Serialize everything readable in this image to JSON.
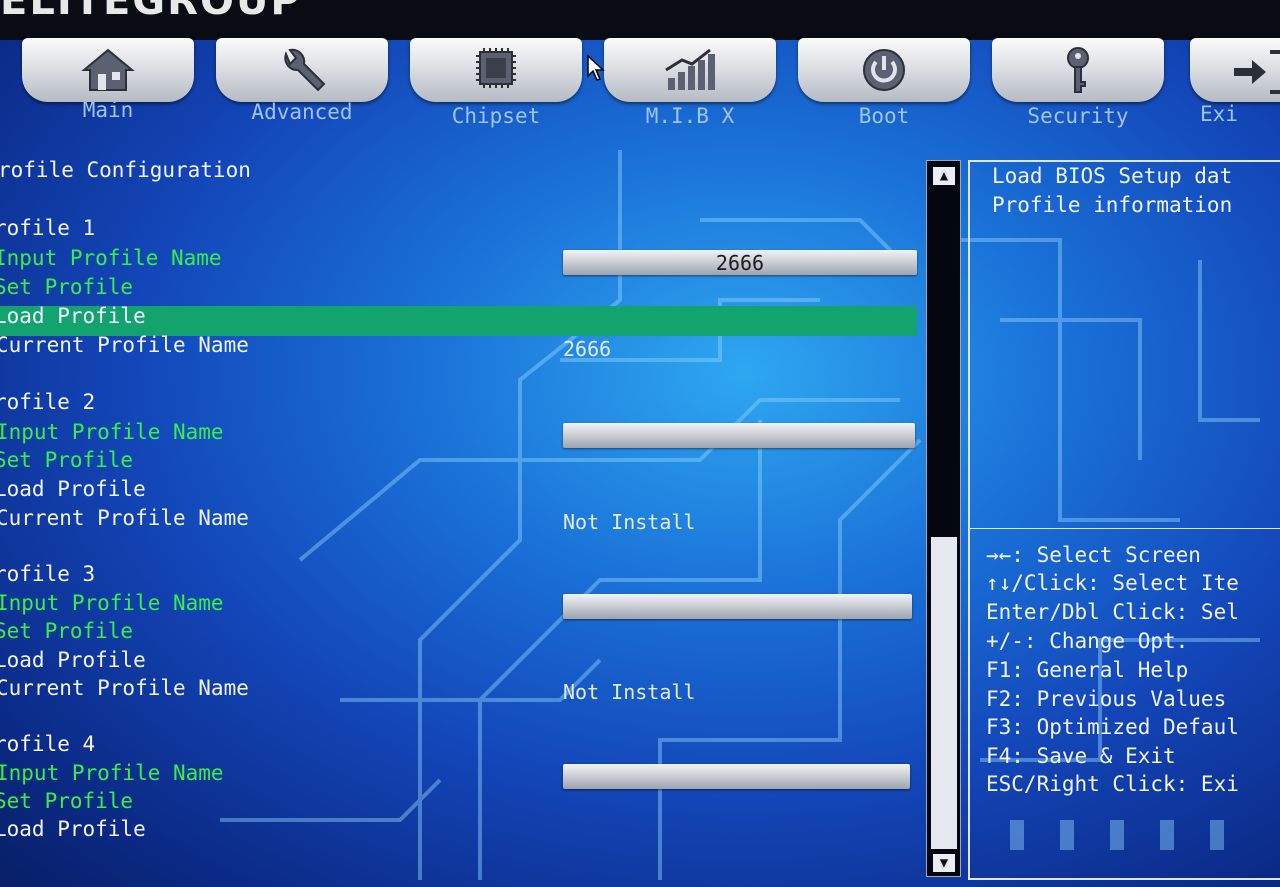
{
  "brand": "ELITEGROUP",
  "tabs": [
    {
      "label": "Main",
      "icon": "home-icon"
    },
    {
      "label": "Advanced",
      "icon": "wrench-icon"
    },
    {
      "label": "Chipset",
      "icon": "chip-icon"
    },
    {
      "label": "M.I.B X",
      "icon": "chart-icon"
    },
    {
      "label": "Boot",
      "icon": "power-icon"
    },
    {
      "label": "Security",
      "icon": "key-icon"
    },
    {
      "label": "Exi",
      "icon": "exit-icon"
    }
  ],
  "page_title": "rofile Configuration",
  "labels": {
    "input_profile_name": "Input Profile Name",
    "set_profile": "Set Profile",
    "load_profile": "Load Profile",
    "current_profile_name": "Current Profile Name"
  },
  "profiles": [
    {
      "title": "rofile 1",
      "input_value": "2666",
      "current_name": "2666"
    },
    {
      "title": "rofile 2",
      "input_value": "",
      "current_name": "Not Install"
    },
    {
      "title": "rofile 3",
      "input_value": "",
      "current_name": "Not Install"
    },
    {
      "title": "rofile 4",
      "input_value": ""
    }
  ],
  "help": {
    "description": [
      "Load BIOS Setup dat",
      "Profile information"
    ],
    "keys": [
      "→←: Select Screen",
      "↑↓/Click: Select Ite",
      "Enter/Dbl Click: Sel",
      "+/-: Change Opt.",
      "F1: General Help",
      "F2: Previous Values",
      "F3: Optimized Defaul",
      "F4: Save & Exit",
      "ESC/Right Click: Exi"
    ]
  },
  "colors": {
    "accent_green": "#35f04a",
    "highlight": "#12a36e"
  }
}
